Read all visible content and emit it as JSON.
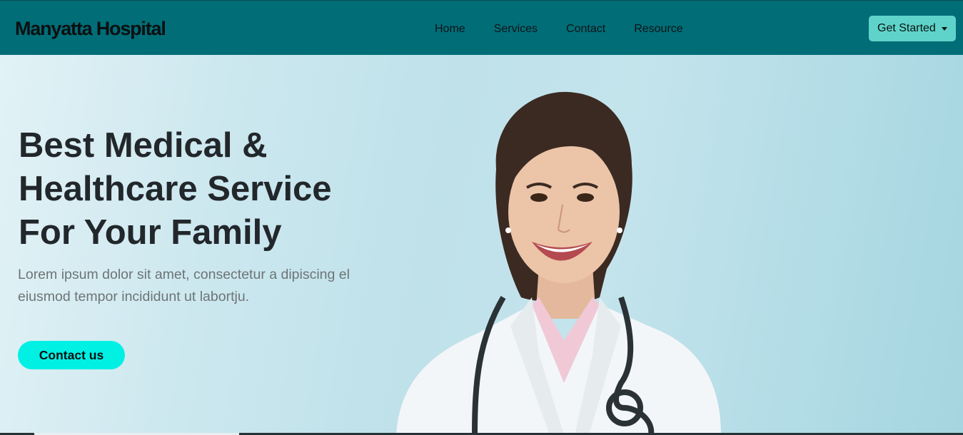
{
  "navbar": {
    "brand": "Manyatta Hospital",
    "links": [
      "Home",
      "Services",
      "Contact",
      "Resource"
    ],
    "cta_label": "Get Started"
  },
  "hero": {
    "title": "Best Medical & Healthcare Service For Your Family",
    "subtitle": "Lorem ipsum dolor sit amet, consectetur a dipiscing el eiusmod tempor incididunt ut labortju.",
    "button_label": "Contact us"
  },
  "colors": {
    "navbar_bg": "#016d77",
    "cta_bg": "#5fd3c9",
    "contact_button_bg": "#00f0e4"
  }
}
